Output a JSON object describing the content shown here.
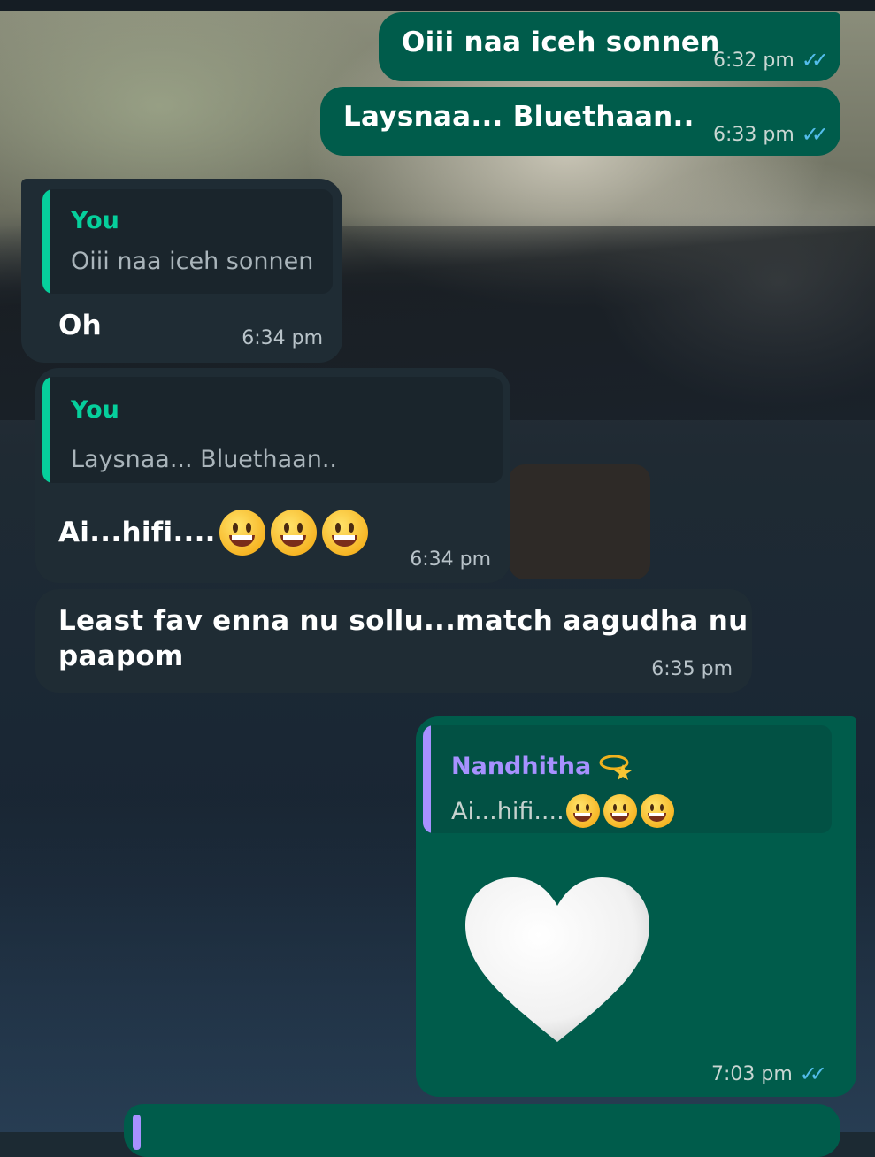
{
  "chat": {
    "messages": [
      {
        "id": "m1",
        "direction": "outgoing",
        "text": "Oiii naa iceh sonnen",
        "time": "6:32 pm",
        "status_ticks": "✓✓"
      },
      {
        "id": "m2",
        "direction": "outgoing",
        "text": "Laysnaa... Bluethaan..",
        "time": "6:33 pm",
        "status_ticks": "✓✓"
      },
      {
        "id": "m3",
        "direction": "incoming",
        "quote": {
          "author": "You",
          "text": "Oiii naa iceh sonnen"
        },
        "text": "Oh",
        "time": "6:34 pm"
      },
      {
        "id": "m4",
        "direction": "incoming",
        "quote": {
          "author": "You",
          "text": "Laysnaa... Bluethaan.."
        },
        "text": "Ai...hifi....",
        "emoji": [
          "grinning-face",
          "grinning-face",
          "grinning-face"
        ],
        "time": "6:34 pm"
      },
      {
        "id": "m5",
        "direction": "incoming",
        "text_line1": "Least fav enna nu sollu...match aagudha nu",
        "text_line2": "paapom",
        "time": "6:35 pm"
      },
      {
        "id": "m6",
        "direction": "outgoing",
        "quote": {
          "author": "Nandhitha",
          "author_emoji": "dizzy-star",
          "text": "Ai...hifi....",
          "emoji": [
            "grinning-face",
            "grinning-face",
            "grinning-face"
          ]
        },
        "sticker": "white-heart",
        "time": "7:03 pm",
        "status_ticks": "✓✓"
      }
    ]
  },
  "colors": {
    "outgoing_bubble": "#005c4b",
    "incoming_bubble": "#1f2c34",
    "read_ticks": "#53bdeb",
    "you_quote_accent": "#06cf9c",
    "nandhitha_quote_accent": "#a791ff"
  }
}
